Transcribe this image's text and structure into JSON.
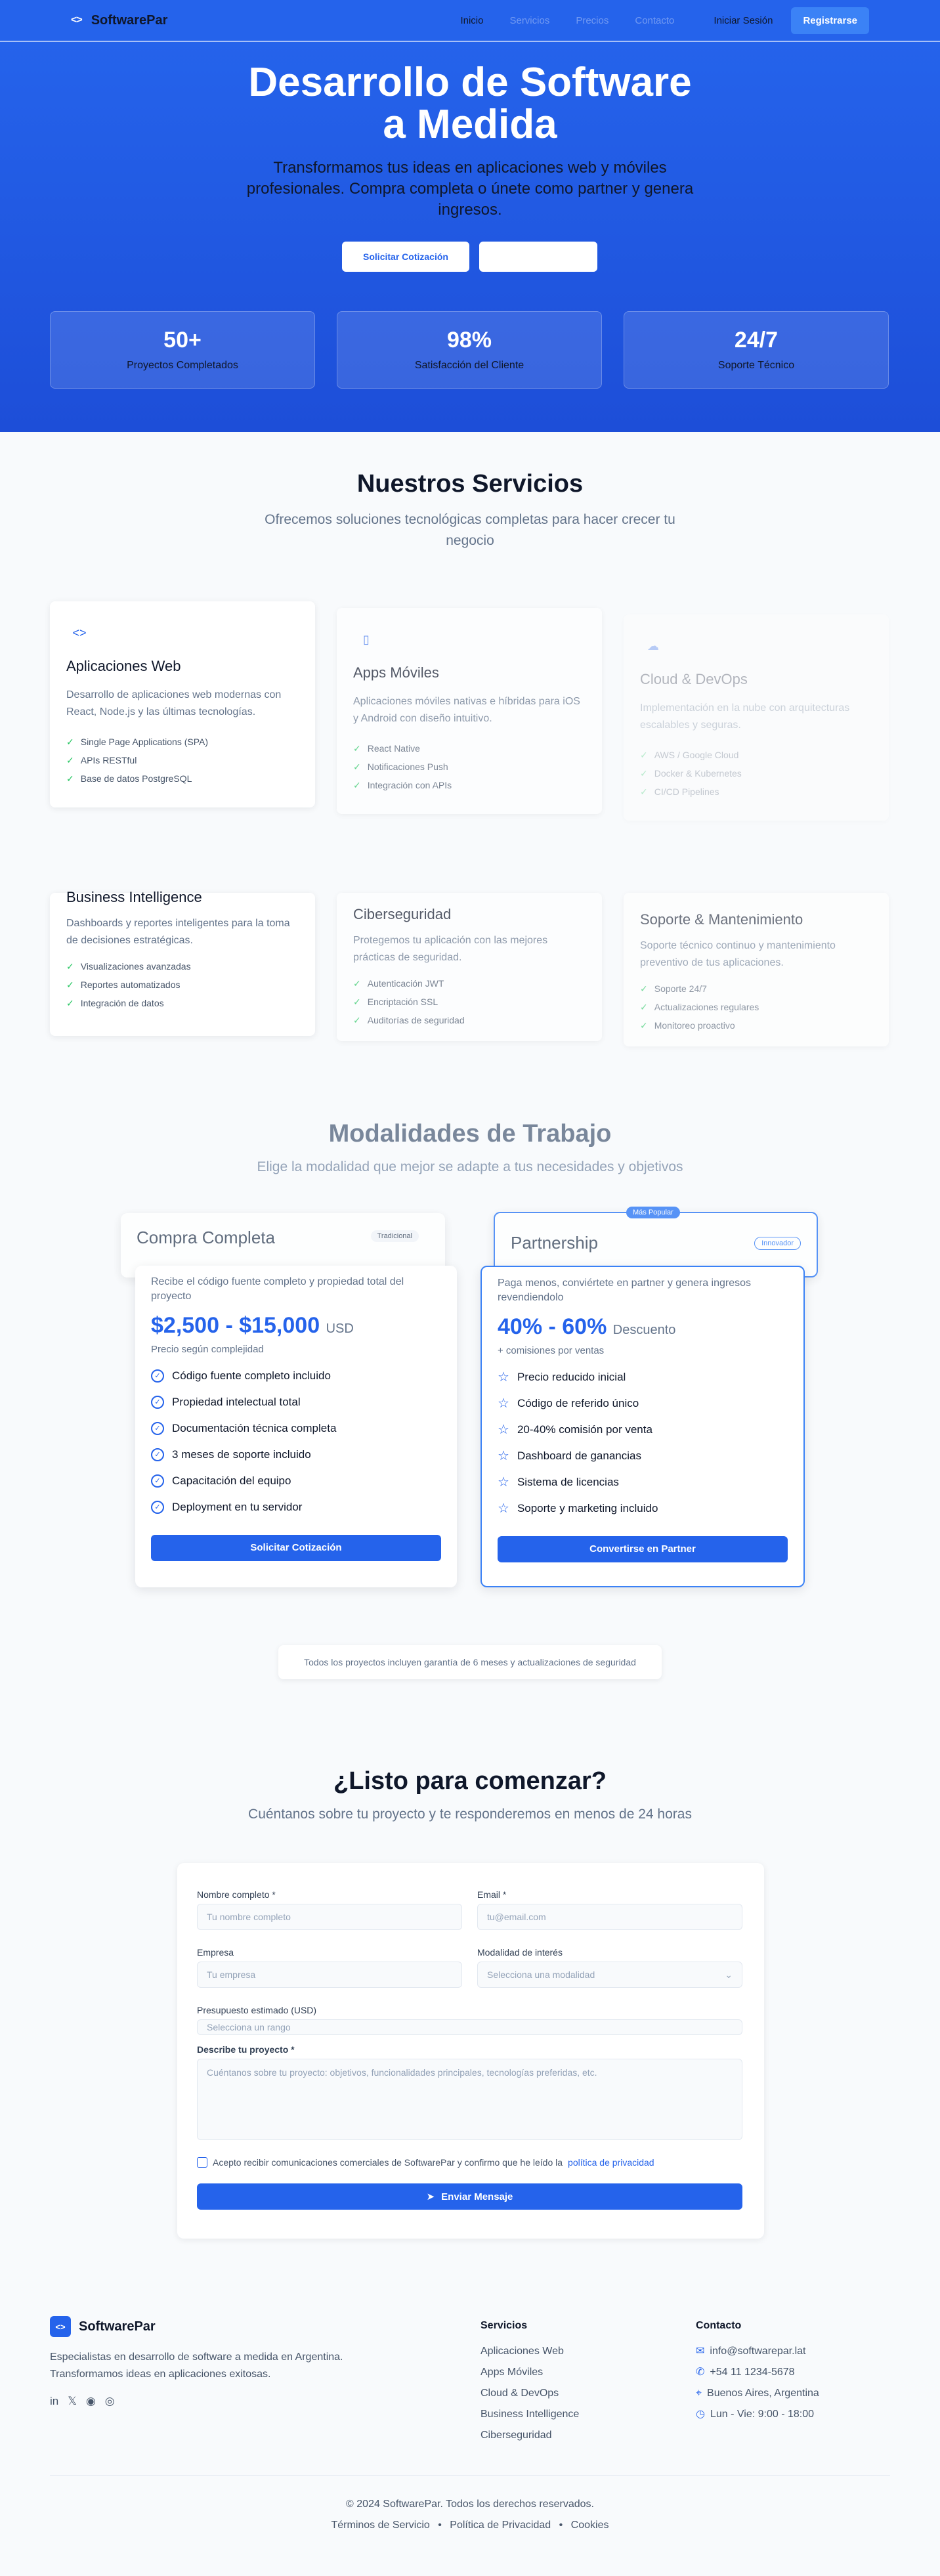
{
  "nav": {
    "brand": "SoftwarePar",
    "links": [
      "Inicio",
      "Servicios",
      "Precios",
      "Contacto"
    ],
    "login": "Iniciar Sesión",
    "register": "Registrarse"
  },
  "hero": {
    "title_line1": "Desarrollo de Software",
    "title_line2": "a Medida",
    "subtitle": "Transformamos tus ideas en aplicaciones web y móviles profesionales. Compra completa o únete como partner y genera ingresos.",
    "cta_primary": "Solicitar Cotización",
    "cta_secondary": "",
    "stats": [
      {
        "num": "50+",
        "label": "Proyectos Completados"
      },
      {
        "num": "98%",
        "label": "Satisfacción del Cliente"
      },
      {
        "num": "24/7",
        "label": "Soporte Técnico"
      }
    ]
  },
  "services": {
    "title": "Nuestros Servicios",
    "subtitle": "Ofrecemos soluciones tecnológicas completas para hacer crecer tu negocio",
    "items": [
      {
        "icon": "code-icon",
        "title": "Aplicaciones Web",
        "desc": "Desarrollo de aplicaciones web modernas con React, Node.js y las últimas tecnologías.",
        "features": [
          "Single Page Applications (SPA)",
          "APIs RESTful",
          "Base de datos PostgreSQL"
        ]
      },
      {
        "icon": "mobile-icon",
        "title": "Apps Móviles",
        "desc": "Aplicaciones móviles nativas e híbridas para iOS y Android con diseño intuitivo.",
        "features": [
          "React Native",
          "Notificaciones Push",
          "Integración con APIs"
        ]
      },
      {
        "icon": "cloud-icon",
        "title": "Cloud & DevOps",
        "desc": "Implementación en la nube con arquitecturas escalables y seguras.",
        "features": [
          "AWS / Google Cloud",
          "Docker & Kubernetes",
          "CI/CD Pipelines"
        ]
      },
      {
        "title": "Business Intelligence",
        "desc": "Dashboards y reportes inteligentes para la toma de decisiones estratégicas.",
        "features": [
          "Visualizaciones avanzadas",
          "Reportes automatizados",
          "Integración de datos"
        ]
      },
      {
        "title": "Ciberseguridad",
        "desc": "Protegemos tu aplicación con las mejores prácticas de seguridad.",
        "features": [
          "Autenticación JWT",
          "Encriptación SSL",
          "Auditorías de seguridad"
        ]
      },
      {
        "title": "Soporte & Mantenimiento",
        "desc": "Soporte técnico continuo y mantenimiento preventivo de tus aplicaciones.",
        "features": [
          "Soporte 24/7",
          "Actualizaciones regulares",
          "Monitoreo proactivo"
        ]
      }
    ]
  },
  "pricing": {
    "title": "Modalidades de Trabajo",
    "subtitle": "Elige la modalidad que mejor se adapte a tus necesidades y objetivos",
    "plans": [
      {
        "name": "Compra Completa",
        "badge": "Tradicional",
        "desc": "Recibe el código fuente completo y propiedad total del proyecto",
        "amount": "$2,500 - $15,000",
        "unit": "USD",
        "note": "Precio según complejidad",
        "features": [
          "Código fuente completo incluido",
          "Propiedad intelectual total",
          "Documentación técnica completa",
          "3 meses de soporte incluido",
          "Capacitación del equipo",
          "Deployment en tu servidor"
        ],
        "button": "Solicitar Cotización"
      },
      {
        "name": "Partnership",
        "badge": "Innovador",
        "top_badge": "Más Popular",
        "desc": "Paga menos, conviértete en partner y genera ingresos revendiendolo",
        "amount": "40% - 60%",
        "unit": "Descuento",
        "note": "+ comisiones por ventas",
        "features": [
          "Precio reducido inicial",
          "Código de referido único",
          "20-40% comisión por venta",
          "Dashboard de ganancias",
          "Sistema de licencias",
          "Soporte y marketing incluido"
        ],
        "button": "Convertirse en Partner"
      }
    ],
    "guarantee": "Todos los proyectos incluyen garantía de 6 meses y actualizaciones de seguridad"
  },
  "contact": {
    "title": "¿Listo para comenzar?",
    "subtitle": "Cuéntanos sobre tu proyecto y te responderemos en menos de 24 horas",
    "name_label": "Nombre completo *",
    "name_placeholder": "Tu nombre completo",
    "email_label": "Email *",
    "email_placeholder": "tu@email.com",
    "company_label": "Empresa",
    "company_placeholder": "Tu empresa",
    "mode_label": "Modalidad de interés",
    "mode_placeholder": "Selecciona una modalidad",
    "budget_label": "Presupuesto estimado (USD)",
    "budget_placeholder": "Selecciona un rango",
    "desc_label": "Describe tu proyecto *",
    "desc_placeholder": "Cuéntanos sobre tu proyecto: objetivos, funcionalidades principales, tecnologías preferidas, etc.",
    "consent_text": "Acepto recibir comunicaciones comerciales de SoftwarePar y confirmo que he leído la",
    "consent_link": "política de privacidad",
    "submit": "Enviar Mensaje"
  },
  "footer": {
    "brand": "SoftwarePar",
    "tagline": "Especialistas en desarrollo de software a medida en Argentina. Transformamos ideas en aplicaciones exitosas.",
    "services_title": "Servicios",
    "services": [
      "Aplicaciones Web",
      "Apps Móviles",
      "Cloud & DevOps",
      "Business Intelligence",
      "Ciberseguridad"
    ],
    "contact_title": "Contacto",
    "email": "info@softwarepar.lat",
    "phone": "+54 11 1234-5678",
    "location": "Buenos Aires, Argentina",
    "hours": "Lun - Vie: 9:00 - 18:00",
    "copyright": "© 2024 SoftwarePar. Todos los derechos reservados.",
    "terms": "Términos de Servicio",
    "privacy": "Política de Privacidad",
    "cookies": "Cookies"
  }
}
